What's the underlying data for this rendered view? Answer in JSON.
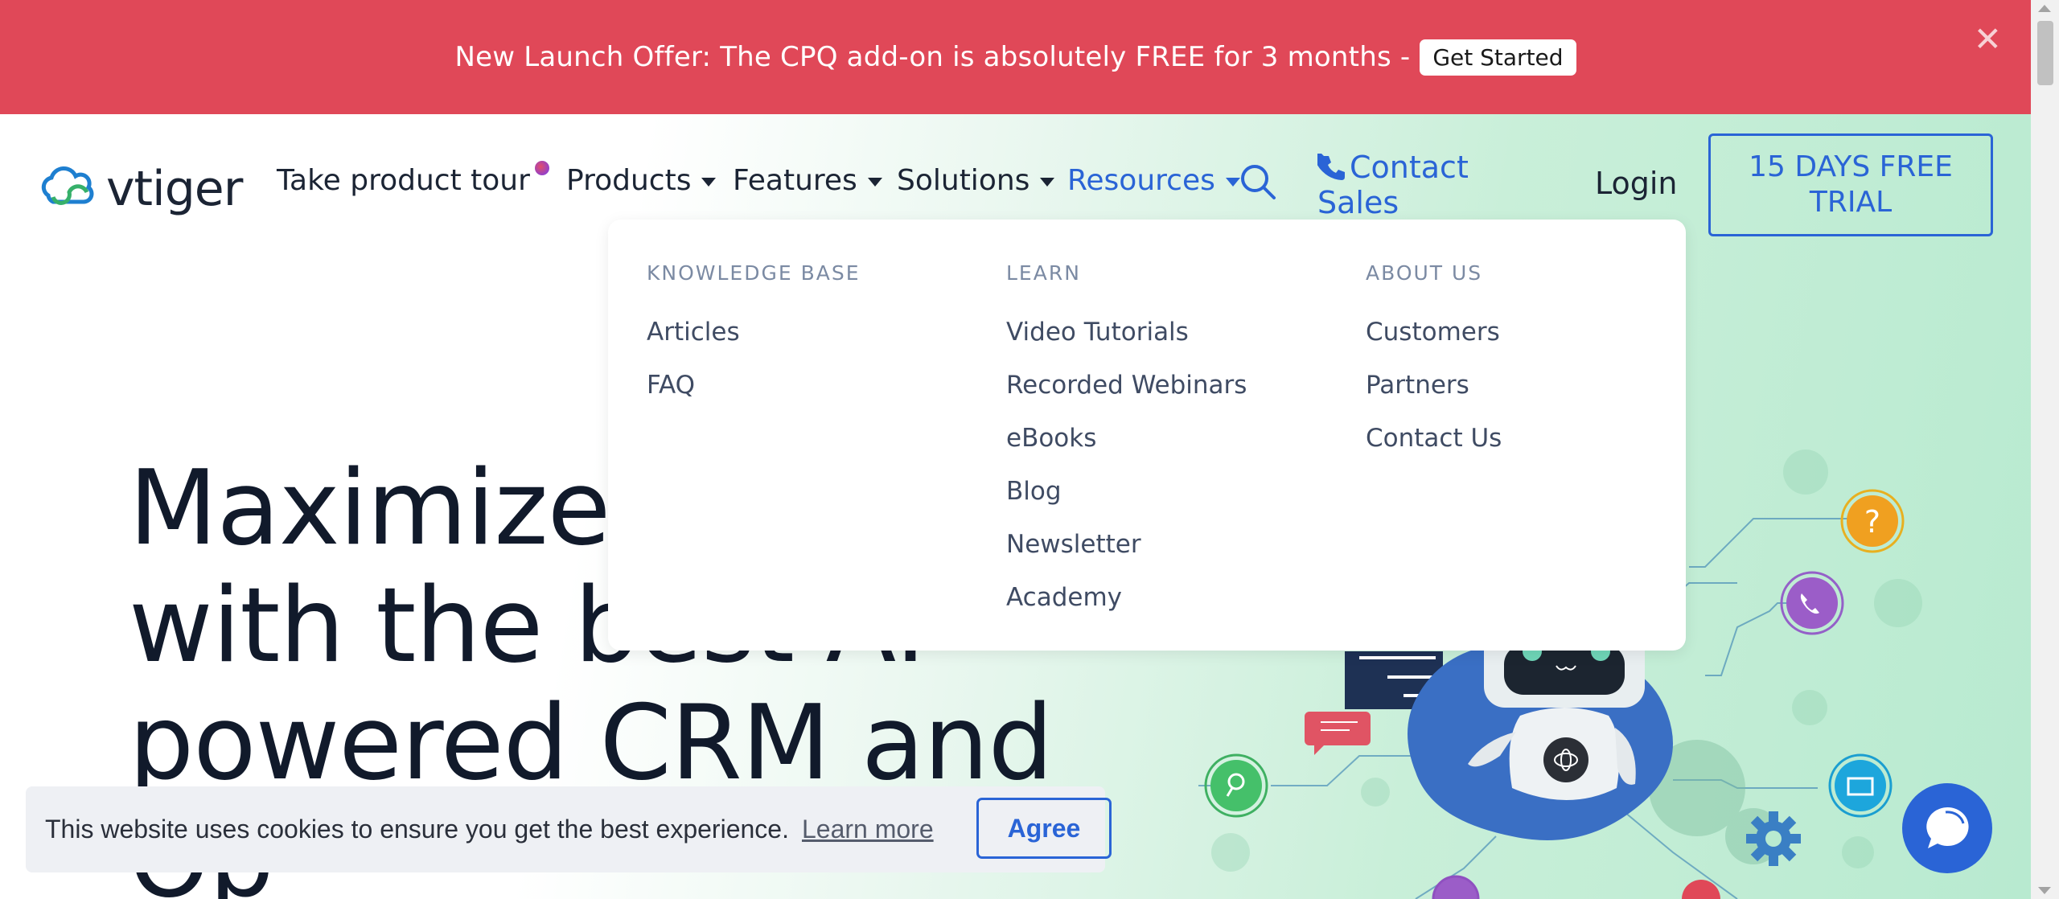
{
  "banner": {
    "text": "New Launch Offer: The CPQ add-on is absolutely FREE for 3 months -",
    "cta_label": "Get Started",
    "close_glyph": "✕"
  },
  "nav": {
    "logo_text": "vtiger",
    "items": [
      {
        "label": "Take product tour"
      },
      {
        "label": "Products"
      },
      {
        "label": "Features"
      },
      {
        "label": "Solutions"
      },
      {
        "label": "Resources"
      }
    ],
    "contact_sales": "Contact Sales",
    "login": "Login",
    "trial": "15 DAYS FREE TRIAL"
  },
  "dropdown": {
    "columns": [
      {
        "heading": "KNOWLEDGE BASE",
        "links": [
          "Articles",
          "FAQ"
        ]
      },
      {
        "heading": "LEARN",
        "links": [
          "Video Tutorials",
          "Recorded Webinars",
          "eBooks",
          "Blog",
          "Newsletter",
          "Academy"
        ]
      },
      {
        "heading": "ABOUT US",
        "links": [
          "Customers",
          "Partners",
          "Contact Us"
        ]
      }
    ]
  },
  "hero": {
    "lines": [
      "Maximize C",
      "with the best AI",
      "powered CRM and",
      "Op"
    ]
  },
  "illustration": {
    "question_glyph": "?"
  },
  "cookie": {
    "message": "This website uses cookies to ensure you get the best experience.",
    "learn_more": "Learn more",
    "agree": "Agree"
  },
  "colors": {
    "banner": "#e04858",
    "accent": "#2a64d6",
    "text_dark": "#1b2434"
  }
}
